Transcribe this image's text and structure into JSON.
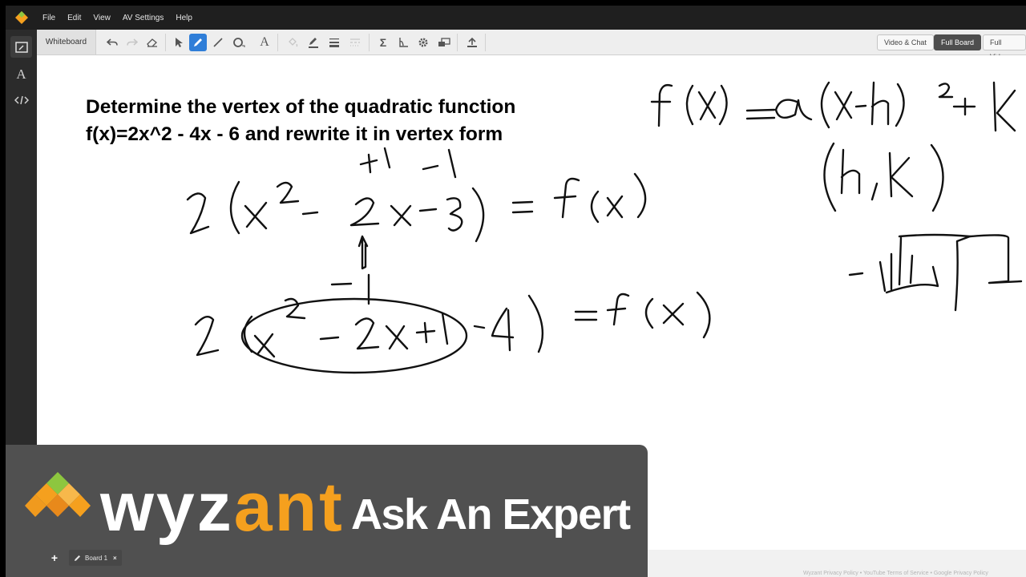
{
  "menu": {
    "items": [
      "File",
      "Edit",
      "View",
      "AV Settings",
      "Help"
    ]
  },
  "toolbar": {
    "tab_label": "Whiteboard",
    "view_buttons": [
      "Video & Chat",
      "Full Board",
      "Full Video"
    ],
    "active_view": "Full Board",
    "active_tool": "pen"
  },
  "problem": {
    "line1": "Determine the vertex of the quadratic function",
    "line2": "f(x)=2x^2 - 4x - 6 and rewrite it in vertex form"
  },
  "handwriting": {
    "vertex_form": "f(x) = a(x-h)^2 + k",
    "vertex_point": "(h, k)",
    "step1_annotation": "+1  -1",
    "step1": "2(x^2 - 2x - 3) = f(x)",
    "step2_annotation": "-1",
    "step2": "2((x^2 - 2x + 1) - 4) = f(x)"
  },
  "banner": {
    "brand_prefix": "wyz",
    "brand_suffix": "ant",
    "tagline": "Ask An Expert"
  },
  "boards": {
    "add_symbol": "+",
    "tab_label": "Board 1",
    "close_symbol": "×"
  },
  "footer": {
    "links": [
      "Wyzant Privacy Policy",
      "YouTube Terms of Service",
      "Google Privacy Policy"
    ]
  },
  "colors": {
    "accent_blue": "#2f7ed8",
    "brand_orange": "#f5a01e",
    "banner_gray": "#505050",
    "menubar": "#1f1f1f"
  }
}
